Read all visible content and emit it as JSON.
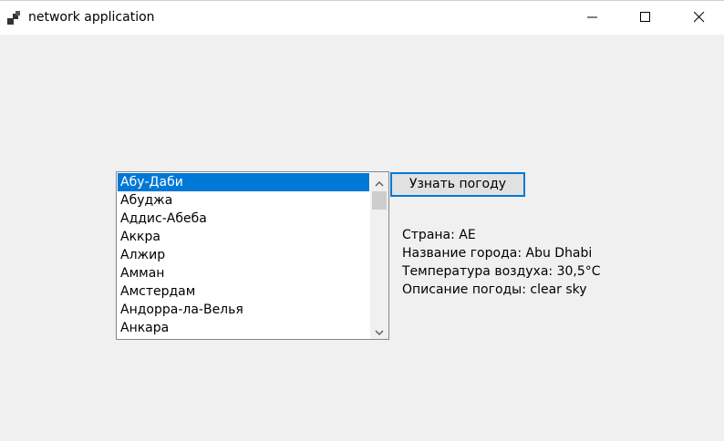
{
  "window": {
    "title": "network application",
    "icon": "app-window-icon",
    "controls": {
      "minimize": "minimize-icon",
      "maximize": "maximize-icon",
      "close": "close-icon"
    }
  },
  "city_list": {
    "items": [
      "Абу-Даби",
      "Абуджа",
      "Аддис-Абеба",
      "Аккра",
      "Алжир",
      "Амман",
      "Амстердам",
      "Андорра-ла-Велья",
      "Анкара"
    ],
    "selected_index": 0
  },
  "weather_button": {
    "label": "Узнать погоду"
  },
  "weather_info": {
    "country": "Страна: AE",
    "city_name": "Название города: Abu Dhabi",
    "temperature": "Температура воздуха: 30,5°C",
    "description": "Описание погоды: clear sky"
  },
  "colors": {
    "selection": "#0078d7",
    "background": "#f0f0f0",
    "button_border": "#0078d7"
  }
}
